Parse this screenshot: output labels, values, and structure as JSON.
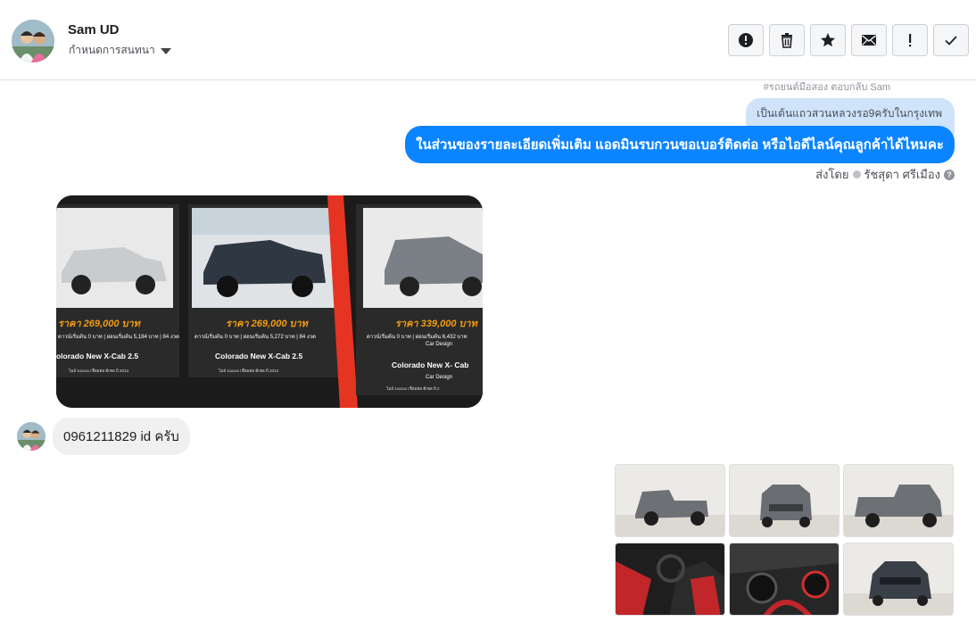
{
  "header": {
    "name": "Sam UD",
    "subtitle": "กำหนดการสนทนา",
    "toolbar": [
      "spam-icon",
      "trash-icon",
      "star-icon",
      "envelope-icon",
      "exclamation-icon",
      "check-icon"
    ]
  },
  "messages": {
    "meta_top": "#รถยนต์มือสอง ตอบกลับ Sam",
    "light_bubble": "เป็นเต้นแถวสวนหลวงรอ9ครับในกรุงเทพ",
    "blue_bubble": "ในส่วนของรายละเอียดเพิ่มเติม แอดมินรบกวนขอเบอร์ติดต่อ หรือไอดีไลน์คุณลูกค้าได้ไหมคะ",
    "sent_by_label": "ส่งโดย",
    "sent_by_name": "รัชสุดา ศรีเมือง",
    "reply": "0961211829 id ครับ"
  },
  "ad_cards": [
    {
      "price": "ราคา 269,000 บาท",
      "line": "ดาวน์เริ่มต้น 0 บาท | ผ่อนเริ่มต้น 5,184 บาท | 84 งวด",
      "model": "olorado New X-Cab 2.5",
      "design": "",
      "footer": "ไมล์ 1xxxxx    เชื่อมต่อ ดีเซล    ปี 2013"
    },
    {
      "price": "ราคา 269,000 บาท",
      "line": "ดาวน์เริ่มต้น 0 บาท | ผ่อนเริ่มต้น 5,272 บาท | 84 งวด",
      "model": "Colorado New X-Cab 2.5",
      "design": "",
      "footer": "ไมล์ 1xxxxx    เชื่อมต่อ ดีเซล    ปี 2013"
    },
    {
      "price": "ราคา 339,000 บาท",
      "line": "ดาวน์เริ่มต้น 0 บาท | ผ่อนเริ่มต้น 6,432 บาท",
      "model": "Colorado New X- Cab",
      "design": "Car Design",
      "footer": "ไมล์ 1xxxxx    เชื่อมต่อ ดีเซล    ปี 2"
    }
  ],
  "colors": {
    "accent": "#0b84ff",
    "price": "#f39c12",
    "stripe": "#e53422"
  }
}
